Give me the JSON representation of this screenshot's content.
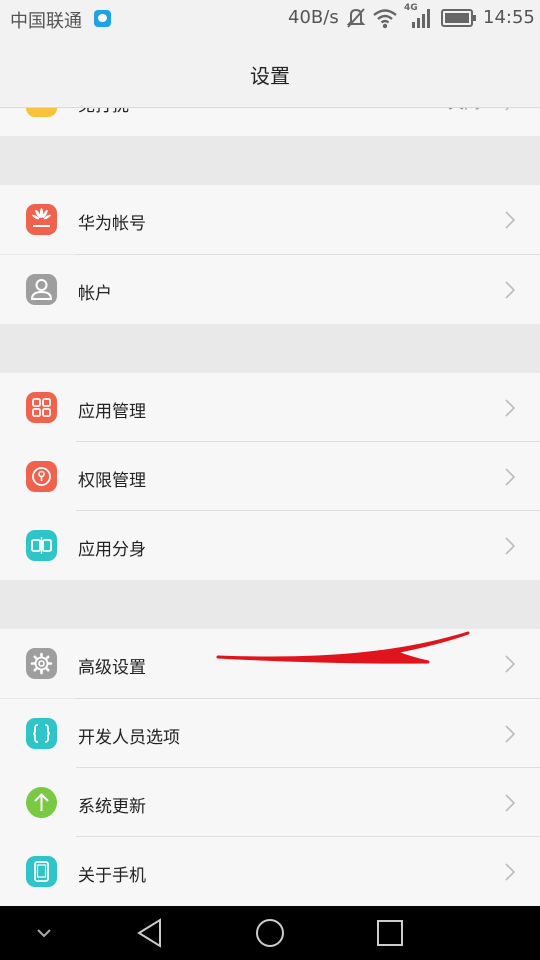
{
  "status_bar": {
    "carrier": "中国联通",
    "net_speed": "40B/s",
    "network_type": "4G",
    "time": "14:55"
  },
  "header": {
    "title": "设置"
  },
  "partial_row": {
    "label": "免打扰",
    "value": "关闭",
    "icon": "moon-icon",
    "color": "#f7c33a"
  },
  "groups": [
    {
      "items": [
        {
          "label": "华为帐号",
          "icon": "huawei-logo-icon",
          "color": "#f0624d"
        },
        {
          "label": "帐户",
          "icon": "user-icon",
          "color": "#9e9e9e"
        }
      ]
    },
    {
      "items": [
        {
          "label": "应用管理",
          "icon": "grid-icon",
          "color": "#f0624d"
        },
        {
          "label": "权限管理",
          "icon": "permission-icon",
          "color": "#f0624d"
        },
        {
          "label": "应用分身",
          "icon": "app-twin-icon",
          "color": "#2ec5c9"
        }
      ]
    },
    {
      "items": [
        {
          "label": "高级设置",
          "icon": "gear-icon",
          "color": "#9e9e9e"
        },
        {
          "label": "开发人员选项",
          "icon": "braces-icon",
          "color": "#2ec5c9"
        },
        {
          "label": "系统更新",
          "icon": "arrow-up-icon",
          "color": "#7ac943"
        },
        {
          "label": "关于手机",
          "icon": "phone-icon",
          "color": "#2ec5c9"
        }
      ]
    }
  ],
  "annotation": {
    "color": "#e0141c"
  },
  "nav_bar": {
    "back": "back-icon",
    "home": "home-icon",
    "recents": "recents-icon",
    "hide": "chevron-down-icon"
  }
}
